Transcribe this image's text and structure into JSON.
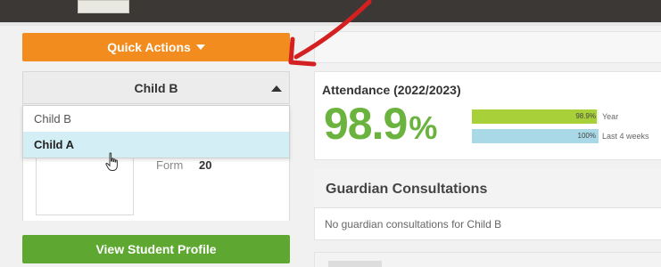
{
  "colors": {
    "topbar": "#3b3836",
    "quick_actions": "#f28c1e",
    "view_profile": "#5ea832",
    "attendance_big": "#6ab33e",
    "bar_year": "#a8d038",
    "bar_weeks": "#a9d9e6",
    "dropdown_selected": "#d4eef6",
    "annotation_arrow": "#d42020"
  },
  "quick_actions": {
    "label": "Quick Actions"
  },
  "child_select": {
    "selected": "Child B",
    "options": [
      "Child B",
      "Child A"
    ],
    "highlighted": "Child A"
  },
  "student": {
    "form_label": "Form",
    "form_value": "20"
  },
  "view_profile": {
    "label": "View Student Profile"
  },
  "attendance": {
    "title": "Attendance (2022/2023)",
    "big_value": "98.9",
    "big_unit": "%",
    "bars": [
      {
        "value_text": "98.9%",
        "label": "Year",
        "fraction": 0.989
      },
      {
        "value_text": "100%",
        "label": "Last 4 weeks",
        "fraction": 1.0
      }
    ]
  },
  "consultations": {
    "title": "Guardian Consultations",
    "message": "No guardian consultations for Child B"
  }
}
